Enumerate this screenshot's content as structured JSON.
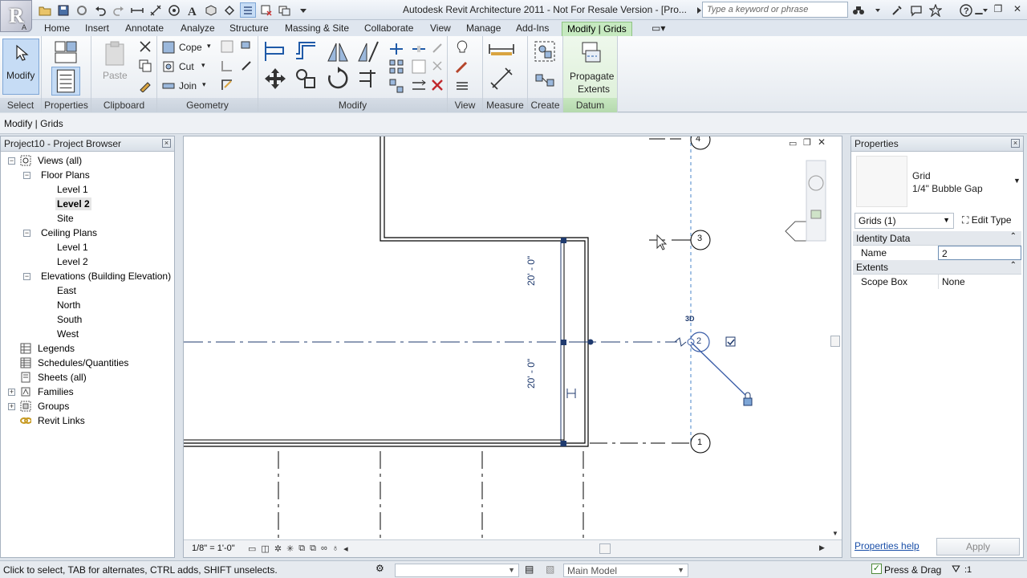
{
  "app": {
    "logo_letter": "R",
    "logo_sub": "A",
    "title": "Autodesk Revit Architecture 2011 - Not For Resale Version - [Pro...",
    "search_placeholder": "Type a keyword or phrase"
  },
  "tabs": [
    "Home",
    "Insert",
    "Annotate",
    "Structure",
    "Massing & Site",
    "Collaborate",
    "View",
    "Manage",
    "Add-Ins",
    "Modify | Grids"
  ],
  "ribbon": {
    "panels": [
      "Select",
      "Properties",
      "Clipboard",
      "Geometry",
      "Modify",
      "View",
      "Measure",
      "Create",
      "Datum"
    ],
    "modify_label": "Modify",
    "paste_label": "Paste",
    "cope_label": "Cope",
    "cut_label": "Cut",
    "join_label": "Join",
    "propagate_label_1": "Propagate",
    "propagate_label_2": "Extents"
  },
  "options_bar": {
    "context": "Modify | Grids"
  },
  "browser": {
    "title": "Project10 - Project Browser",
    "items": [
      "Views (all)",
      "Floor Plans",
      "Level 1",
      "Level 2",
      "Site",
      "Ceiling Plans",
      "Level 1",
      "Level 2",
      "Elevations (Building Elevation)",
      "East",
      "North",
      "South",
      "West",
      "Legends",
      "Schedules/Quantities",
      "Sheets (all)",
      "Families",
      "Groups",
      "Revit Links"
    ]
  },
  "view": {
    "scale": "1/8\" = 1'-0\"",
    "grid_labels": [
      "4",
      "3",
      "2",
      "1"
    ],
    "dim_top": "20' - 0\"",
    "dim_bottom": "20' - 0\"",
    "tag_3d": "3D"
  },
  "properties": {
    "title": "Properties",
    "family": "Grid",
    "type": "1/4\" Bubble Gap",
    "selector": "Grids (1)",
    "edit_type": "Edit Type",
    "sections": [
      "Identity Data",
      "Extents"
    ],
    "name_key": "Name",
    "name_value": "2",
    "scope_key": "Scope Box",
    "scope_value": "None",
    "help": "Properties help",
    "apply": "Apply"
  },
  "status": {
    "message": "Click to select, TAB for alternates, CTRL adds, SHIFT unselects.",
    "workset": "Main Model",
    "press_drag": "Press & Drag",
    "filter_count": ":1"
  },
  "colors": {
    "accent_tab": "#c6e9c0",
    "grid_line": "#1f3a6e",
    "selection": "#3b5ea8"
  }
}
